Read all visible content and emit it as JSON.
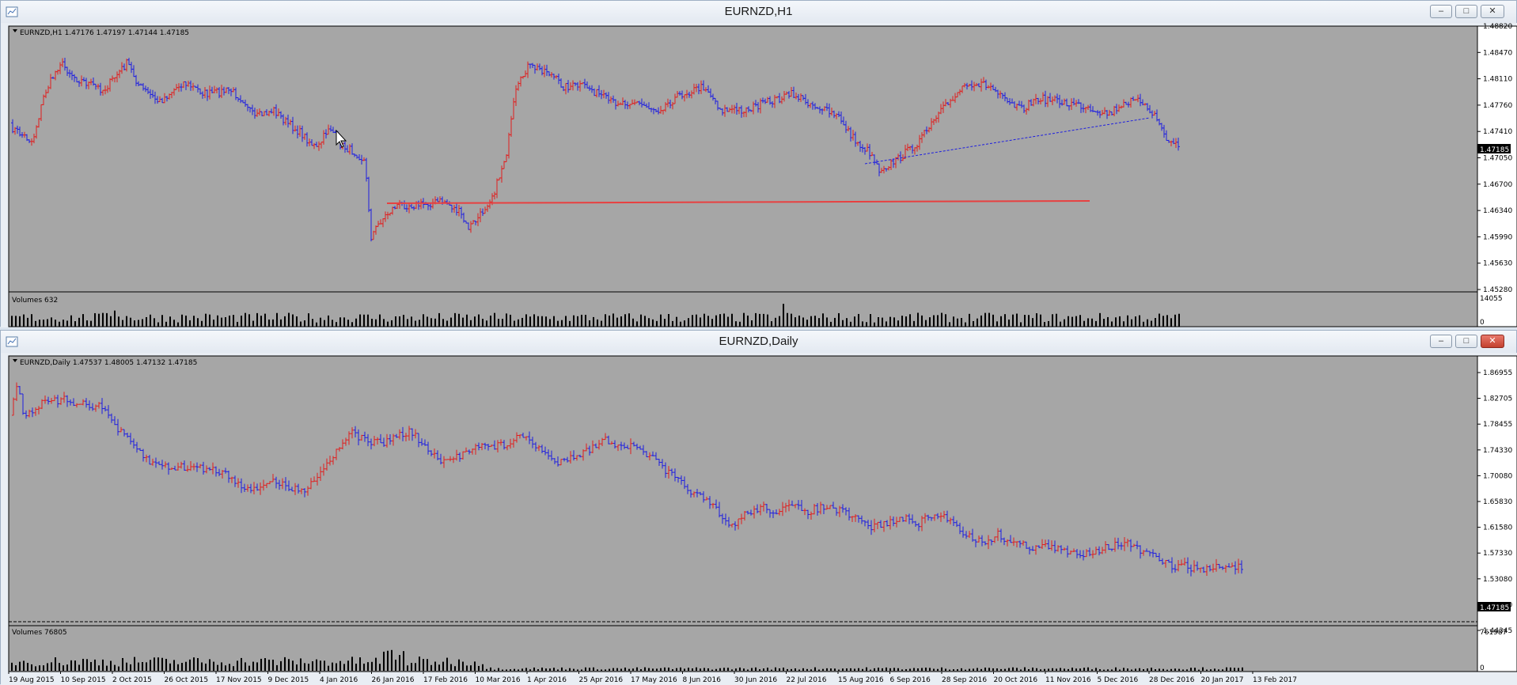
{
  "window_top": {
    "title": "EURNZD,H1",
    "info": "EURNZD,H1  1.47176 1.47197 1.47144 1.47185",
    "volumes": "Volumes 632",
    "price_labels": [
      "1.48820",
      "1.48470",
      "1.48110",
      "1.47760",
      "1.47410",
      "1.47050",
      "1.46700",
      "1.46340",
      "1.45990",
      "1.45630",
      "1.45280"
    ],
    "current_price": "1.47185",
    "volume_labels": [
      "14055",
      "0"
    ],
    "minimize": "–",
    "maximize": "□",
    "close": "✕"
  },
  "window_bottom": {
    "title": "EURNZD,Daily",
    "info": "EURNZD,Daily  1.47537 1.48005 1.47132 1.47185",
    "volumes": "Volumes 76805",
    "price_labels": [
      "1.86955",
      "1.82705",
      "1.78455",
      "1.74330",
      "1.70080",
      "1.65830",
      "1.61580",
      "1.57330",
      "1.53080",
      "1.48830",
      "1.44345"
    ],
    "current_price": "1.47185",
    "volume_labels": [
      "761987",
      "0"
    ],
    "minimize": "–",
    "maximize": "□",
    "close": "✕"
  },
  "dates": [
    "19 Aug 2015",
    "10 Sep 2015",
    "2 Oct 2015",
    "26 Oct 2015",
    "17 Nov 2015",
    "9 Dec 2015",
    "4 Jan 2016",
    "26 Jan 2016",
    "17 Feb 2016",
    "10 Mar 2016",
    "1 Apr 2016",
    "25 Apr 2016",
    "17 May 2016",
    "8 Jun 2016",
    "30 Jun 2016",
    "22 Jul 2016",
    "15 Aug 2016",
    "6 Sep 2016",
    "28 Sep 2016",
    "20 Oct 2016",
    "11 Nov 2016",
    "5 Dec 2016",
    "28 Dec 2016",
    "20 Jan 2017",
    "13 Feb 2017"
  ],
  "colors": {
    "bg": "#a6a6a6",
    "up": "#e01e1e",
    "down": "#1e1ee0",
    "line": "#e84040",
    "text": "#000000"
  },
  "icons": {
    "cursor": "mouse-pointer-icon"
  }
}
